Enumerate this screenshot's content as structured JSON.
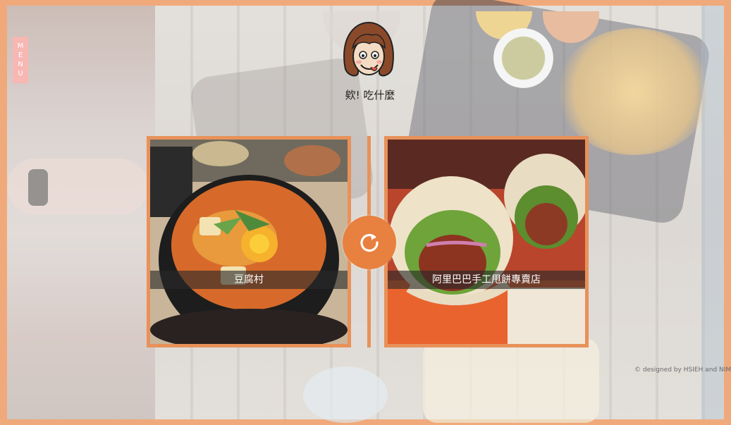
{
  "menu": {
    "label_letters": [
      "M",
      "E",
      "N",
      "U"
    ]
  },
  "header": {
    "title": "欸! 吃什麼"
  },
  "cards": [
    {
      "name": "豆腐村"
    },
    {
      "name": "阿里巴巴手工甩餅專賣店"
    }
  ],
  "refresh_icon": "refresh-icon",
  "footer": {
    "credit": "© designed by HSIEH and NIMO"
  },
  "colors": {
    "accent": "#e8803f",
    "frame": "#f0a97a",
    "menu_tab": "#f7b7b3"
  }
}
